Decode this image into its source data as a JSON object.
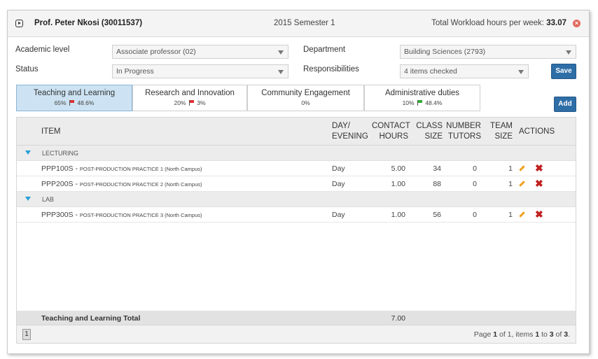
{
  "header": {
    "name": "Prof. Peter Nkosi (30011537)",
    "semester": "2015 Semester 1",
    "workload_label": "Total Workload hours per week:",
    "workload_value": "33.07"
  },
  "form": {
    "academic_level_label": "Academic level",
    "academic_level_value": "Associate professor (02)",
    "status_label": "Status",
    "status_value": "In Progress",
    "department_label": "Department",
    "department_value": "Building Sciences (2793)",
    "responsibilities_label": "Responsibilities",
    "responsibilities_value": "4 items checked",
    "save_label": "Save",
    "add_label": "Add"
  },
  "tabs": [
    {
      "label": "Teaching and Learning",
      "pct": "65%",
      "flag": "red",
      "flag_pct": "48.6%"
    },
    {
      "label": "Research and Innovation",
      "pct": "20%",
      "flag": "red",
      "flag_pct": "3%"
    },
    {
      "label": "Community Engagement",
      "pct": "0%",
      "flag": "",
      "flag_pct": ""
    },
    {
      "label": "Administrative duties",
      "pct": "10%",
      "flag": "green",
      "flag_pct": "48.4%"
    }
  ],
  "columns": {
    "item": "Item",
    "day_1": "Day/",
    "day_2": "Evening",
    "contact_1": "Contact",
    "contact_2": "Hours",
    "class_1": "Class",
    "class_2": "Size",
    "tutors_1": "Number",
    "tutors_2": "Tutors",
    "team_1": "Team",
    "team_2": "Size",
    "actions": "Actions"
  },
  "groups": [
    {
      "label": "LECTURING",
      "rows": [
        {
          "code": "PPP100S - ",
          "desc": "POST-PRODUCTION PRACTICE 1 (North Campus)",
          "day": "Day",
          "hours": "5.00",
          "class_size": "34",
          "tutors": "0",
          "team": "1"
        },
        {
          "code": "PPP200S - ",
          "desc": "POST-PRODUCTION PRACTICE 2 (North Campus)",
          "day": "Day",
          "hours": "1.00",
          "class_size": "88",
          "tutors": "0",
          "team": "1"
        }
      ]
    },
    {
      "label": "LAB",
      "rows": [
        {
          "code": "PPP300S - ",
          "desc": "POST-PRODUCTION PRACTICE 3 (North Campus)",
          "day": "Day",
          "hours": "1.00",
          "class_size": "56",
          "tutors": "0",
          "team": "1"
        }
      ]
    }
  ],
  "total": {
    "label": "Teaching and Learning Total",
    "hours": "7.00"
  },
  "pager": {
    "page_button": "1",
    "t1": "Page ",
    "page": "1",
    "t2": " of ",
    "pages": "1",
    "t3": ", items ",
    "from": "1",
    "t4": " to ",
    "to": "3",
    "t5": " of ",
    "count": "3",
    "t6": "."
  },
  "icons": {
    "expand": "expand-icon",
    "close": "close-circle-icon",
    "flag": "flag-icon",
    "edit": "pencil-icon",
    "delete": "delete-x-icon"
  }
}
